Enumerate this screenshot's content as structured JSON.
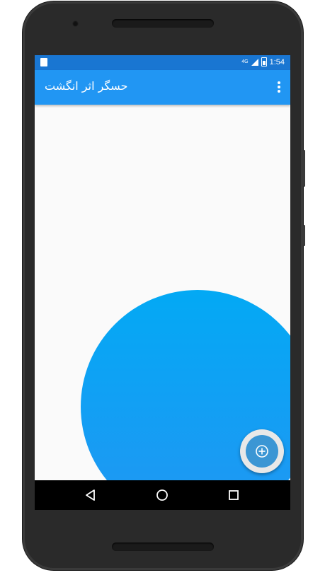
{
  "status_bar": {
    "network": "4G",
    "time": "1:54",
    "sd_card_icon": "sd-card-icon",
    "signal_icon": "signal-icon",
    "battery_icon": "battery-icon"
  },
  "app_bar": {
    "title": "حسگر اثر انگشت",
    "menu_icon": "more-vert-icon",
    "color": "#2196f3"
  },
  "content": {
    "circle_colors": [
      "#03a9f4",
      "#2196f3"
    ]
  },
  "fab": {
    "icon": "add-circle-icon",
    "color": "#3b96d4"
  },
  "nav_bar": {
    "back_icon": "back-icon",
    "home_icon": "home-icon",
    "recents_icon": "recents-icon"
  }
}
